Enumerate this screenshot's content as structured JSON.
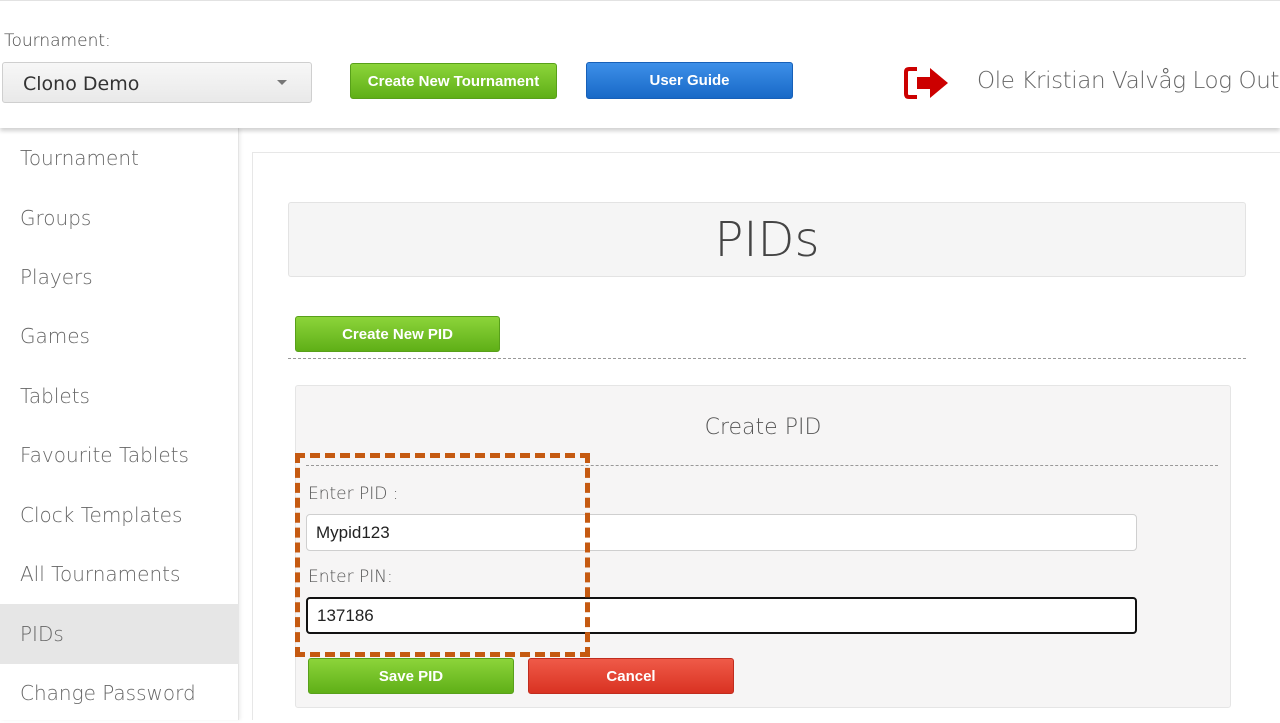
{
  "header": {
    "tournament_label": "Tournament:",
    "tournament_select": {
      "value": "Clono Demo"
    },
    "create_tournament_label": "Create New Tournament",
    "user_guide_label": "User Guide",
    "user_logout_text": "Ole Kristian Valvåg Log Out",
    "logout_icon": "logout-arrow-icon"
  },
  "sidebar": {
    "items": [
      {
        "label": "Tournament"
      },
      {
        "label": "Groups"
      },
      {
        "label": "Players"
      },
      {
        "label": "Games"
      },
      {
        "label": "Tablets"
      },
      {
        "label": "Favourite Tablets"
      },
      {
        "label": "Clock Templates"
      },
      {
        "label": "All Tournaments"
      },
      {
        "label": "PIDs",
        "active": true
      },
      {
        "label": "Change Password"
      }
    ]
  },
  "main": {
    "page_title": "PIDs",
    "create_pid_button": "Create New PID",
    "form": {
      "title": "Create PID",
      "pid_label": "Enter PID :",
      "pid_value": "Mypid123",
      "pin_label": "Enter PIN:",
      "pin_value": "137186",
      "save_label": "Save PID",
      "cancel_label": "Cancel"
    }
  },
  "colors": {
    "green_button": "#6cbf22",
    "blue_button": "#2a7bd8",
    "red_button": "#e2432f",
    "logout_icon": "#cc0000",
    "annotation_box": "#c55a11"
  }
}
